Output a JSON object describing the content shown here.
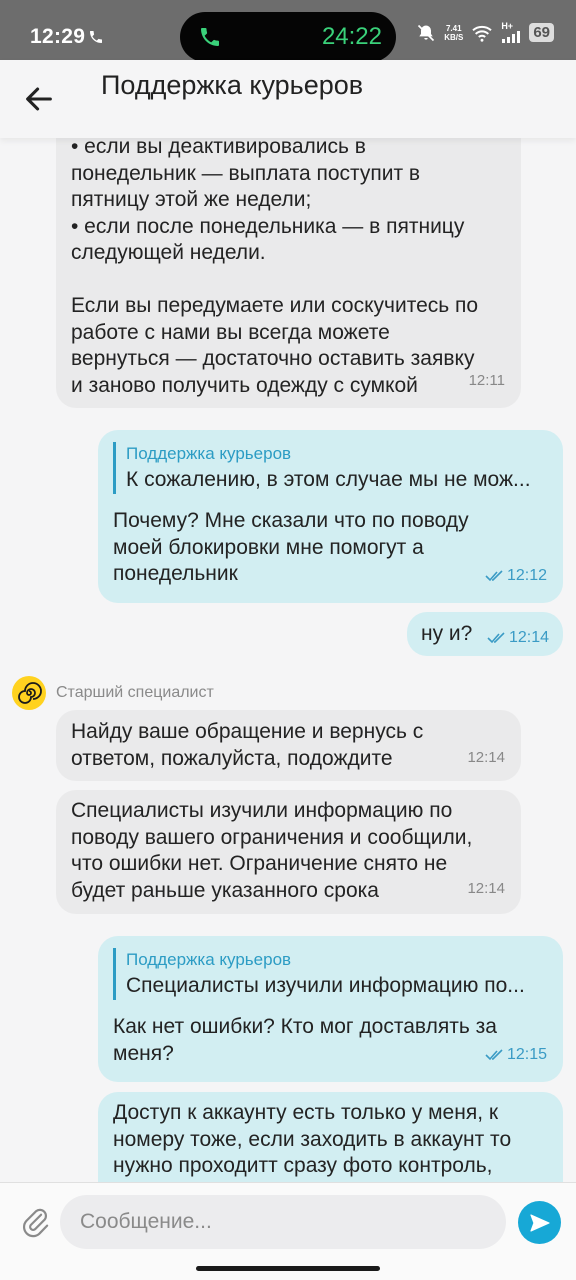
{
  "status_bar": {
    "time": "12:29",
    "call_timer": "24:22",
    "net_speed_value": "7.41",
    "net_speed_unit": "KB/S",
    "network_type": "H+",
    "battery": "69"
  },
  "header": {
    "title": "Поддержка курьеров"
  },
  "messages": {
    "m1": {
      "lines": [
        "• если вы деактивировались в",
        "понедельник — выплата поступит в",
        "пятницу этой же недели;",
        "• если после понедельника — в пятницу",
        "следующей недели.",
        "",
        "Если вы передумаете или соскучитесь по",
        "работе с нами вы всегда можете",
        "вернуться — достаточно оставить заявку",
        "и заново получить одежду с сумкой"
      ],
      "time": "12:11"
    },
    "m2": {
      "quote_author": "Поддержка курьеров",
      "quote_text": "К сожалению, в этом случае мы не мож...",
      "lines": [
        "Почему? Мне сказали что по поводу",
        "моей блокировки мне помогут а",
        "понедельник"
      ],
      "time": "12:12"
    },
    "m3": {
      "text": "ну и?",
      "time": "12:14"
    },
    "sender": {
      "name": "Старший специалист"
    },
    "m4": {
      "lines": [
        "Найду ваше обращение и вернусь с",
        "ответом, пожалуйста, подождите"
      ],
      "time": "12:14"
    },
    "m5": {
      "lines": [
        "Специалисты изучили информацию по",
        "поводу вашего ограничения и сообщили,",
        "что ошибки нет. Ограничение снято не",
        "будет раньше указанного срока"
      ],
      "time": "12:14"
    },
    "m6": {
      "quote_author": "Поддержка курьеров",
      "quote_text": "Специалисты изучили информацию по...",
      "lines": [
        "Как нет ошибки? Кто мог доставлять за",
        "меня?"
      ],
      "time": "12:15"
    },
    "m7": {
      "lines": [
        "Доступ к аккаунту есть только у меня, к",
        "номеру тоже, если заходить в аккаунт то",
        "нужно проходитт сразу фото контроль,"
      ]
    }
  },
  "composer": {
    "placeholder": "Сообщение..."
  },
  "colors": {
    "accent": "#17a8d6",
    "incoming_bubble": "#eaeaeb",
    "outgoing_bubble": "#d2eef2",
    "call_timer": "#3ad17a"
  }
}
